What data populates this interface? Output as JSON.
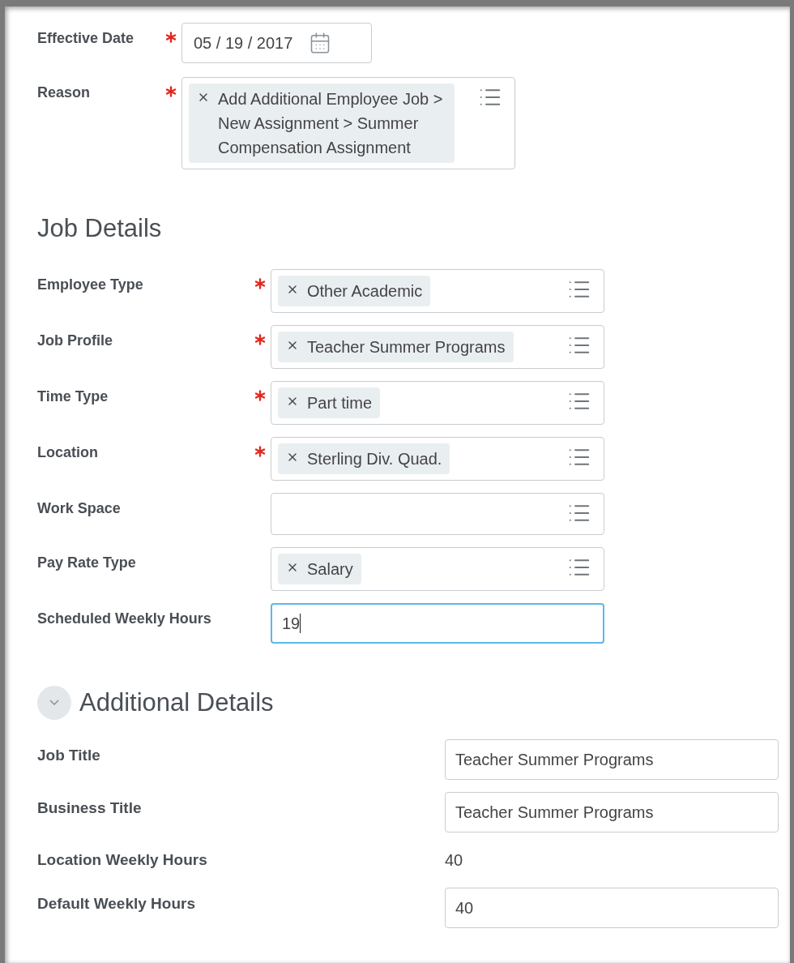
{
  "top_fields": [
    {
      "label": "Effective Date",
      "required": true,
      "kind": "date",
      "value": "05 / 19 / 2017"
    },
    {
      "label": "Reason",
      "required": true,
      "kind": "prompt",
      "tokens": [
        "Add Additional Employee Job > New Assignment > Summer Compensation Assignment"
      ]
    }
  ],
  "job_details": {
    "heading": "Job Details",
    "fields": [
      {
        "label": "Employee Type",
        "required": true,
        "kind": "prompt",
        "tokens": [
          "Other Academic"
        ]
      },
      {
        "label": "Job Profile",
        "required": true,
        "kind": "prompt",
        "tokens": [
          "Teacher Summer Programs"
        ]
      },
      {
        "label": "Time Type",
        "required": true,
        "kind": "prompt",
        "tokens": [
          "Part time"
        ]
      },
      {
        "label": "Location",
        "required": true,
        "kind": "prompt",
        "tokens": [
          "Sterling Div. Quad."
        ]
      },
      {
        "label": "Work Space",
        "required": false,
        "kind": "prompt"
      },
      {
        "label": "Pay Rate Type",
        "required": false,
        "kind": "prompt",
        "tokens": [
          "Salary"
        ]
      },
      {
        "label": "Scheduled Weekly Hours",
        "required": false,
        "kind": "text",
        "value": "19",
        "focused": true
      }
    ]
  },
  "additional_details": {
    "heading": "Additional Details",
    "fields": [
      {
        "label": "Job Title",
        "kind": "text",
        "value": "Teacher Summer Programs",
        "focused": false
      },
      {
        "label": "Business Title",
        "kind": "text",
        "value": "Teacher Summer Programs",
        "focused": false
      },
      {
        "label": "Location Weekly Hours",
        "kind": "readonly",
        "value": "40"
      },
      {
        "label": "Default Weekly Hours",
        "kind": "text",
        "value": "40",
        "focused": false
      }
    ]
  }
}
